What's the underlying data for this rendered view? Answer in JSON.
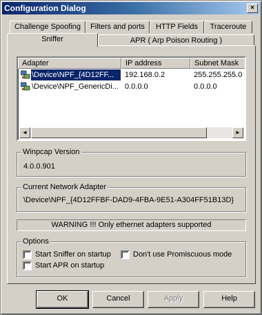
{
  "window": {
    "title": "Configuration Dialog",
    "close_glyph": "×"
  },
  "tabs": {
    "row1": [
      "Challenge Spoofing",
      "Filters and ports",
      "HTTP Fields",
      "Traceroute"
    ],
    "row2": [
      "Sniffer",
      "APR ( Arp Poison Routing )"
    ],
    "active": "Sniffer"
  },
  "adapters": {
    "columns": [
      "Adapter",
      "IP address",
      "Subnet Mask"
    ],
    "rows": [
      {
        "adapter": "\\Device\\NPF_{4D12FF...",
        "ip": "192.168.0.2",
        "mask": "255.255.255.0",
        "selected": true,
        "icon": "network-adapter-icon"
      },
      {
        "adapter": "\\Device\\NPF_GenericDi...",
        "ip": "0.0.0.0",
        "mask": "0.0.0.0",
        "selected": false,
        "icon": "network-adapter-icon"
      }
    ],
    "scroll_left": "◄",
    "scroll_right": "►"
  },
  "winpcap": {
    "label": "Winpcap Version",
    "value": "4.0.0.901"
  },
  "current_adapter": {
    "label": "Current Network Adapter",
    "value": "\\Device\\NPF_{4D12FFBF-DAD9-4FBA-9E51-A304FF51B13D}"
  },
  "warning": "WARNING !!! Only ethernet adapters supported",
  "options": {
    "label": "Options",
    "start_sniffer": "Start Sniffer on startup",
    "no_promiscuous": "Don't use Promiscuous mode",
    "start_apr": "Start APR on startup"
  },
  "buttons": {
    "ok": "OK",
    "cancel": "Cancel",
    "apply": "Apply",
    "help": "Help"
  },
  "colors": {
    "selection": "#0a246a",
    "face": "#d4d0c8",
    "title_start": "#0a246a"
  }
}
